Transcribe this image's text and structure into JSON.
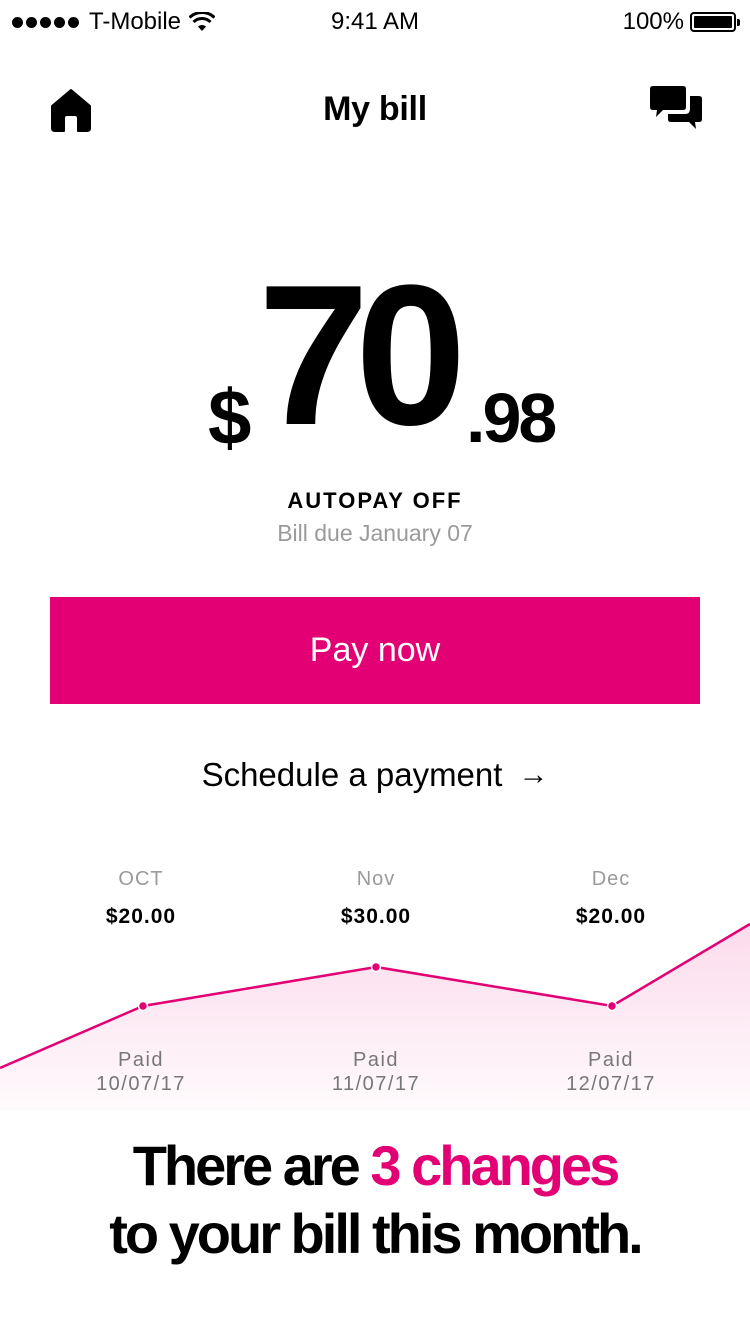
{
  "status_bar": {
    "carrier": "T-Mobile",
    "time": "9:41 AM",
    "battery": "100%"
  },
  "nav": {
    "title": "My bill",
    "home_icon": "home-icon",
    "chat_icon": "chat-icon"
  },
  "bill": {
    "currency": "$",
    "dollars": "70",
    "cents": ".98",
    "autopay": "AUTOPAY OFF",
    "due": "Bill due January 07"
  },
  "actions": {
    "pay_now": "Pay now",
    "schedule": "Schedule a payment",
    "schedule_arrow": "→"
  },
  "history": {
    "months": [
      {
        "label": "OCT",
        "amount": "$20.00",
        "status": "Paid",
        "date": "10/07/17"
      },
      {
        "label": "Nov",
        "amount": "$30.00",
        "status": "Paid",
        "date": "11/07/17"
      },
      {
        "label": "Dec",
        "amount": "$20.00",
        "status": "Paid",
        "date": "12/07/17"
      }
    ]
  },
  "chart_data": {
    "type": "area",
    "categories": [
      "OCT",
      "Nov",
      "Dec"
    ],
    "values": [
      20.0,
      30.0,
      20.0
    ]
  },
  "changes": {
    "prefix": "There are ",
    "highlight": "3 changes",
    "suffix": "to your bill this month."
  },
  "colors": {
    "accent": "#e20074",
    "muted": "#9a9a9a"
  }
}
